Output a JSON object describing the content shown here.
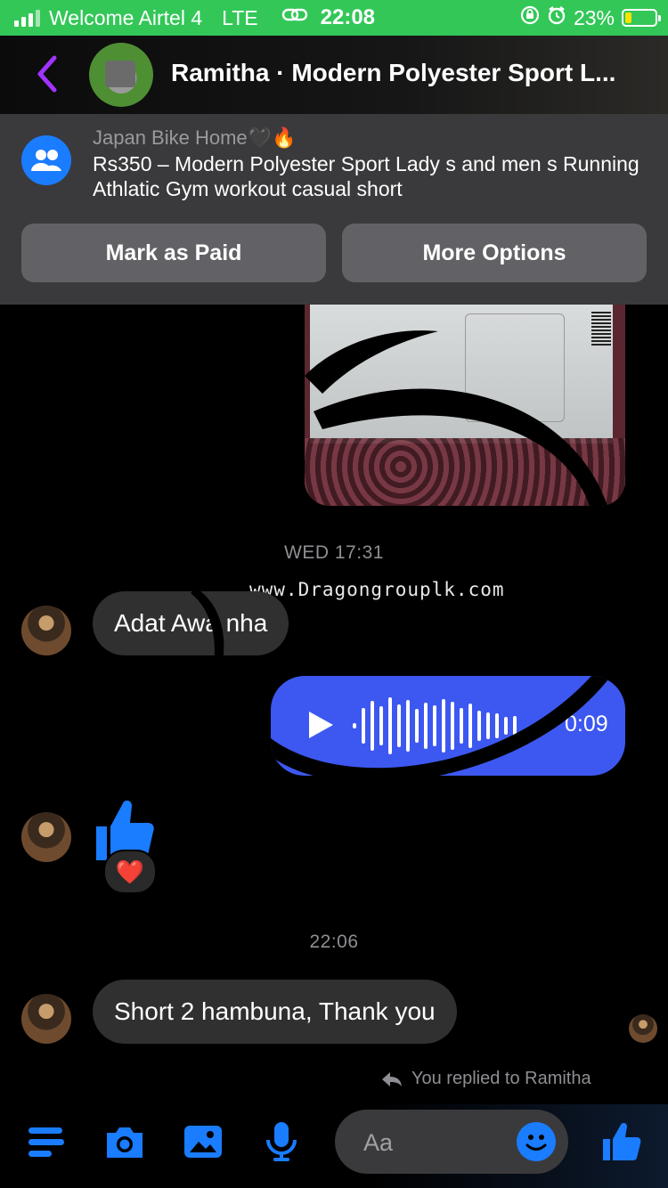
{
  "status_bar": {
    "carrier": "Welcome Airtel 4",
    "network": "LTE",
    "time": "22:08",
    "battery_percent": "23%",
    "battery_level": 0.23
  },
  "header": {
    "title": "Ramitha · Modern Polyester Sport L...",
    "back_icon": "chevron-left-icon"
  },
  "product_banner": {
    "shop_name": "Japan Bike Home🖤🔥",
    "product_title": "Rs350 – Modern Polyester Sport Lady s and men s Running Athlatic Gym workout casual short",
    "mark_paid_label": "Mark as Paid",
    "more_options_label": "More Options"
  },
  "conversation": {
    "timestamp_1": "WED 17:31",
    "watermark": "www.Dragongrouplk.com",
    "message_1": "Adat Awa nha",
    "voice_duration": "0:09",
    "reaction_emoji": "❤️",
    "timestamp_2": "22:06",
    "message_2": "Short 2 hambuna, Thank you",
    "replied_text": "You replied to Ramitha"
  },
  "composer": {
    "placeholder": "Aa"
  },
  "colors": {
    "status_green": "#33c758",
    "messenger_blue": "#1a7cff",
    "voice_bubble": "#3d58f0",
    "back_purple": "#a033ff"
  }
}
